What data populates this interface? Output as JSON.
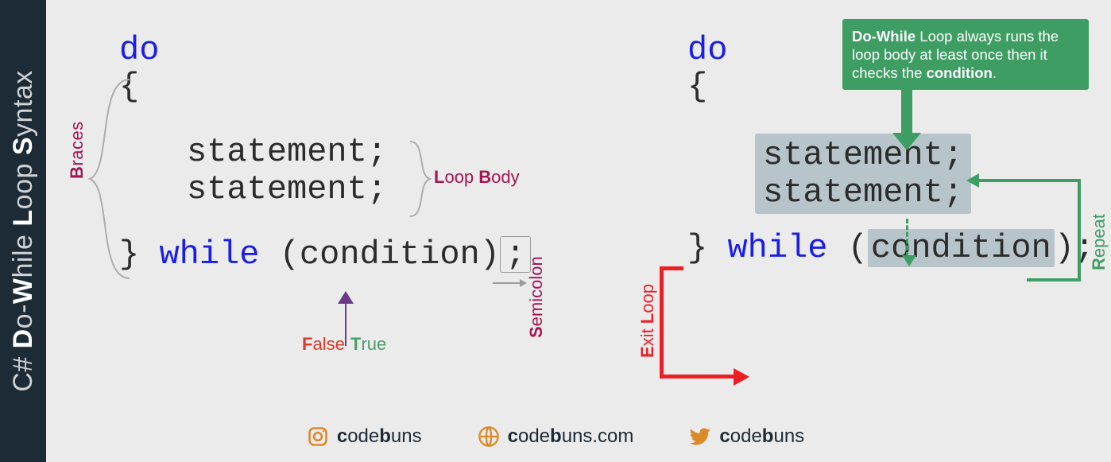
{
  "sidebar": {
    "lang": "C#",
    "title_parts": [
      "D",
      "o-",
      "W",
      "hile ",
      "L",
      "oop ",
      "S",
      "yntax"
    ]
  },
  "left": {
    "do_kw": "do",
    "open_brace": "{",
    "stmt1": "statement;",
    "stmt2": "statement;",
    "close_brace": "}",
    "while_kw": "while",
    "open_paren": "(",
    "condition": "condition",
    "close_paren": ")",
    "semicolon": ";",
    "braces_label": {
      "first": "B",
      "rest": "races"
    },
    "loop_body_label_L": {
      "first": "L",
      "rest": "oop "
    },
    "loop_body_label_B": {
      "first": "B",
      "rest": "ody"
    },
    "false": {
      "first": "F",
      "rest": "alse"
    },
    "true": {
      "first": "T",
      "rest": "rue"
    },
    "semicolon_label": {
      "first": "S",
      "rest": "emicolon"
    }
  },
  "right": {
    "do_kw": "do",
    "open_brace": "{",
    "stmt1": "statement;",
    "stmt2": "statement;",
    "close_brace": "}",
    "while_kw": "while",
    "open_paren": "(",
    "condition": "condition",
    "close_paren": ")",
    "semicolon": ";",
    "tip_before": "",
    "tip_b1": "Do-While",
    "tip_mid": " Loop always runs the loop body at least once then it checks the ",
    "tip_b2": "condition",
    "tip_after": ".",
    "repeat": {
      "first": "R",
      "rest": "epeat"
    },
    "exit_E": {
      "first": "E",
      "rest": "xit "
    },
    "exit_L": {
      "first": "L",
      "rest": "oop"
    }
  },
  "footer": {
    "ig": {
      "c": "c",
      "ode": "ode",
      "b": "b",
      "uns": "uns"
    },
    "site": {
      "c": "c",
      "ode": "ode",
      "b": "b",
      "unscom": "uns.com"
    },
    "tw": {
      "c": "c",
      "ode": "ode",
      "b": "b",
      "uns": "uns"
    }
  }
}
